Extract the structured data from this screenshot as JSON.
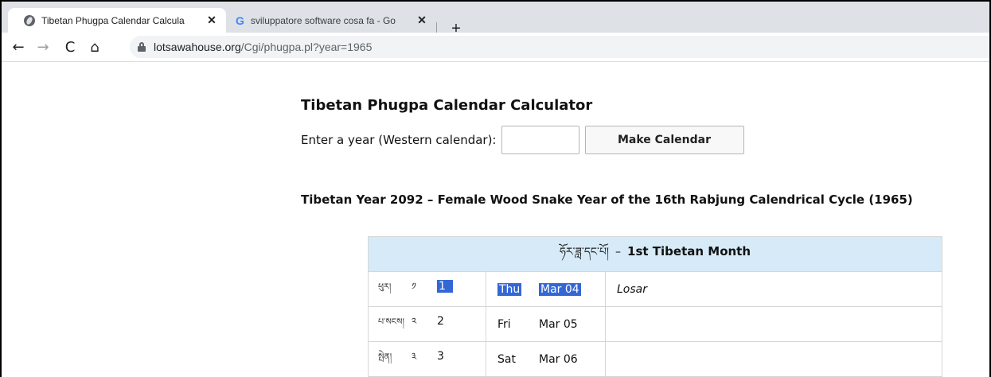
{
  "browser": {
    "tabs": [
      {
        "title": "Tibetan Phugpa Calendar Calcula",
        "close": "✕",
        "active": true
      },
      {
        "title": "sviluppatore software cosa fa - Go",
        "close": "✕",
        "active": false
      }
    ],
    "new_tab": "+",
    "nav": {
      "back": "←",
      "forward": "→",
      "reload": "C",
      "home": "⌂"
    },
    "url": {
      "host": "lotsawahouse.org",
      "path": "/Cgi/phugpa.pl?year=1965"
    }
  },
  "page": {
    "title": "Tibetan Phugpa Calendar Calculator",
    "form": {
      "label": "Enter a year (Western calendar):",
      "input_value": "",
      "button": "Make Calendar"
    },
    "year_heading": "Tibetan Year 2092 – Female Wood Snake Year of the 16th Rabjung Calendrical Cycle (1965)",
    "calendar": {
      "month_tibetan": "ཧོར་ཟླ་དང་པོ།",
      "month_dash": "–",
      "month_english": "1st Tibetan Month",
      "rows": [
        {
          "tib_day": "ཕུར།",
          "tib_num": "༡",
          "lunar_day": "1",
          "weekday": "Thu",
          "date": "Mar 04",
          "event": "Losar"
        },
        {
          "tib_day": "པ་སངས།",
          "tib_num": "༢",
          "lunar_day": "2",
          "weekday": "Fri",
          "date": "Mar 05",
          "event": ""
        },
        {
          "tib_day": "སྤེན།",
          "tib_num": "༣",
          "lunar_day": "3",
          "weekday": "Sat",
          "date": "Mar 06",
          "event": ""
        }
      ]
    }
  }
}
